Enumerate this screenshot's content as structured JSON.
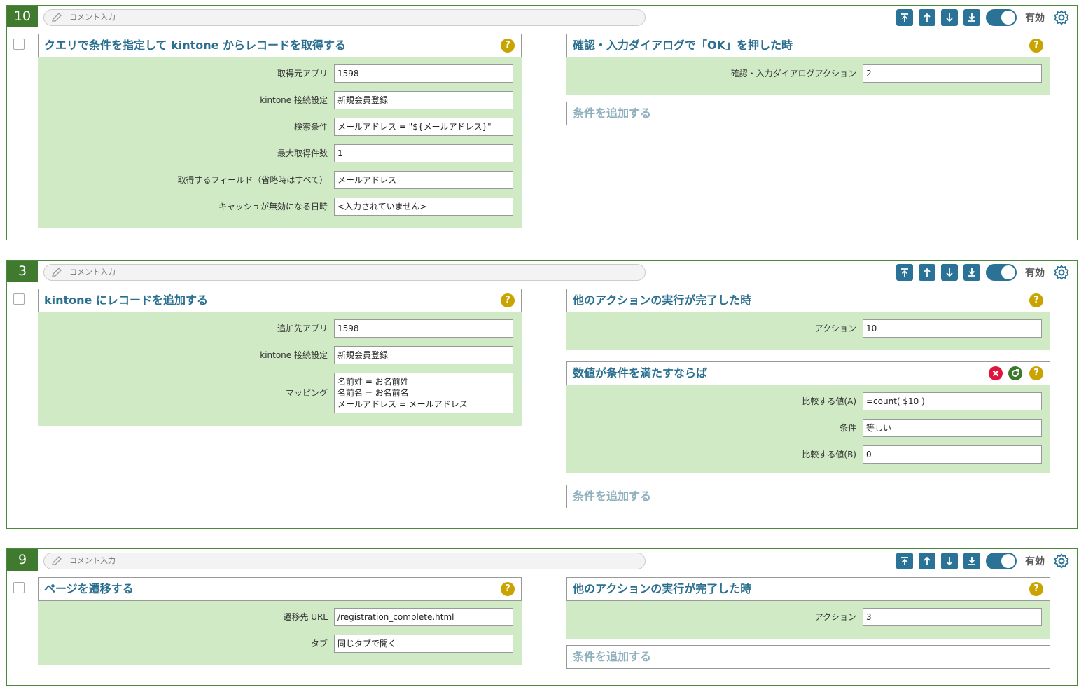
{
  "comment_placeholder": "コメント入力",
  "valid_label": "有効",
  "help_label": "?",
  "add_condition_label": "条件を追加する",
  "blocks": [
    {
      "number": "10",
      "action": {
        "title": "クエリで条件を指定して kintone からレコードを取得する",
        "fields": [
          {
            "label": "取得元アプリ",
            "value": "1598"
          },
          {
            "label": "kintone 接続設定",
            "value": "新規会員登録"
          },
          {
            "label": "検索条件",
            "value": "メールアドレス = \"${メールアドレス}\""
          },
          {
            "label": "最大取得件数",
            "value": "1"
          },
          {
            "label": "取得するフィールド（省略時はすべて）",
            "value": "メールアドレス"
          },
          {
            "label": "キャッシュが無効になる日時",
            "value": "<入力されていません>"
          }
        ]
      },
      "trigger": {
        "title": "確認・入力ダイアログで「OK」を押した時",
        "fields": [
          {
            "label": "確認・入力ダイアログアクション",
            "value": "2"
          }
        ]
      }
    },
    {
      "number": "3",
      "action": {
        "title": "kintone にレコードを追加する",
        "fields": [
          {
            "label": "追加先アプリ",
            "value": "1598"
          },
          {
            "label": "kintone 接続設定",
            "value": "新規会員登録"
          },
          {
            "label": "マッピング",
            "value_lines": [
              "名前姓 = お名前姓",
              "名前名 = お名前名",
              "メールアドレス = メールアドレス"
            ]
          }
        ]
      },
      "trigger": {
        "title": "他のアクションの実行が完了した時",
        "fields": [
          {
            "label": "アクション",
            "value": "10"
          }
        ]
      },
      "condition": {
        "title": "数値が条件を満たすならば",
        "fields": [
          {
            "label": "比較する値(A)",
            "value": "=count( $10 )"
          },
          {
            "label": "条件",
            "value": "等しい"
          },
          {
            "label": "比較する値(B)",
            "value": "0"
          }
        ]
      }
    },
    {
      "number": "9",
      "action": {
        "title": "ページを遷移する",
        "fields": [
          {
            "label": "遷移先 URL",
            "value": "/registration_complete.html"
          },
          {
            "label": "タブ",
            "value": "同じタブで開く"
          }
        ]
      },
      "trigger": {
        "title": "他のアクションの実行が完了した時",
        "fields": [
          {
            "label": "アクション",
            "value": "3"
          }
        ]
      }
    }
  ]
}
